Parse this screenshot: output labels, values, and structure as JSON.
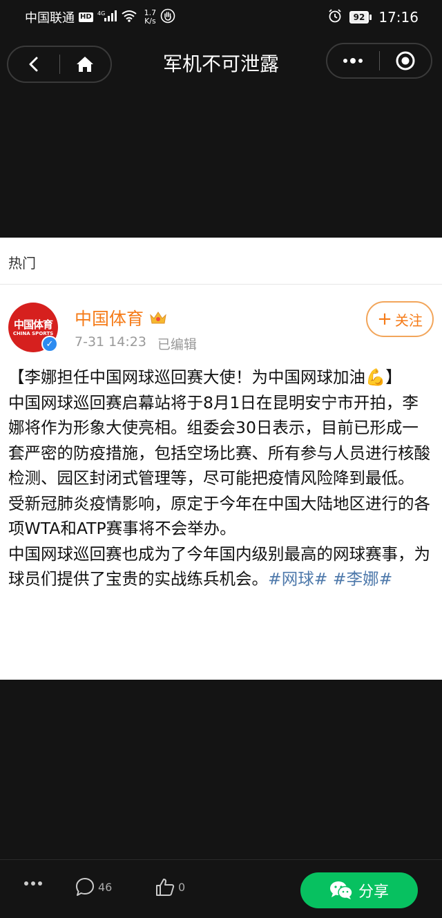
{
  "status_bar": {
    "carrier": "中国联通",
    "hd_badge": "HD",
    "network": "4G",
    "speed_value": "1.7",
    "speed_unit": "K/s",
    "battery": "92",
    "time": "17:16"
  },
  "title_bar": {
    "title": "军机不可泄露"
  },
  "section": {
    "label": "热门"
  },
  "post": {
    "avatar_text_cn": "中国体育",
    "avatar_text_en": "CHINA SPORTS",
    "username": "中国体育",
    "date": "7-31 14:23",
    "edited": "已编辑",
    "follow_label": "关注",
    "headline": "【李娜担任中国网球巡回赛大使！为中国网球加油💪】",
    "paragraph1": "中国网球巡回赛启幕站将于8月1日在昆明安宁市开拍，李娜将作为形象大使亮相。组委会30日表示，目前已形成一套严密的防疫措施，包括空场比赛、所有参与人员进行核酸检测、园区封闭式管理等，尽可能把疫情风险降到最低。",
    "paragraph2": "受新冠肺炎疫情影响，原定于今年在中国大陆地区进行的各项WTA和ATP赛事将不会举办。",
    "paragraph3": "中国网球巡回赛也成为了今年国内级别最高的网球赛事，为球员们提供了宝贵的实战练兵机会。",
    "hashtag1": "#网球#",
    "hashtag2": "#李娜#"
  },
  "bottom_bar": {
    "comment_count": "46",
    "like_count": "0",
    "share_label": "分享"
  },
  "colors": {
    "accent_orange": "#f57b18",
    "wechat_green": "#07c160",
    "hashtag_blue": "#4e79ab",
    "background_dark": "#141414"
  }
}
